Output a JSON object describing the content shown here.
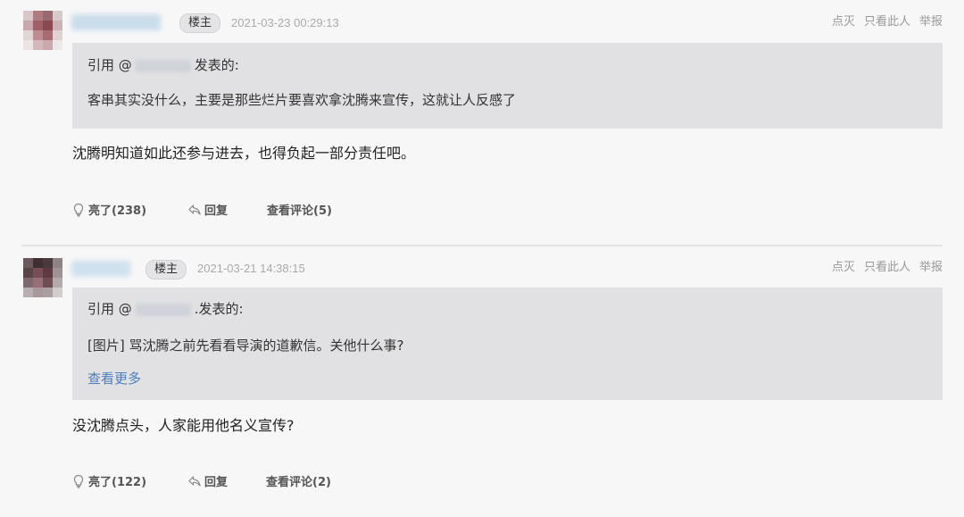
{
  "posts": [
    {
      "badge": "楼主",
      "time": "2021-03-23 00:29:13",
      "links": [
        "点灭",
        "只看此人",
        "举报"
      ],
      "quote_prefix": "引用 @",
      "quote_suffix": "发表的:",
      "quote_lines": [
        "客串其实没什么，主要是那些烂片要喜欢拿沈腾来宣传，这就让人反感了"
      ],
      "reply": "沈腾明知道如此还参与进去，也得负起一部分责任吧。",
      "like_label": "亮了(238)",
      "reply_label": "回复",
      "comments_label": "查看评论(5)"
    },
    {
      "badge": "楼主",
      "time": "2021-03-21 14:38:15",
      "links": [
        "点灭",
        "只看此人",
        "举报"
      ],
      "quote_prefix": "引用 @",
      "quote_suffix": ".发表的:",
      "quote_lines": [
        "[图片] 骂沈腾之前先看看导演的道歉信。关他什么事?"
      ],
      "more": "查看更多",
      "reply": "没沈腾点头，人家能用他名义宣传?",
      "like_label": "亮了(122)",
      "reply_label": "回复",
      "comments_label": "查看评论(2)"
    }
  ]
}
